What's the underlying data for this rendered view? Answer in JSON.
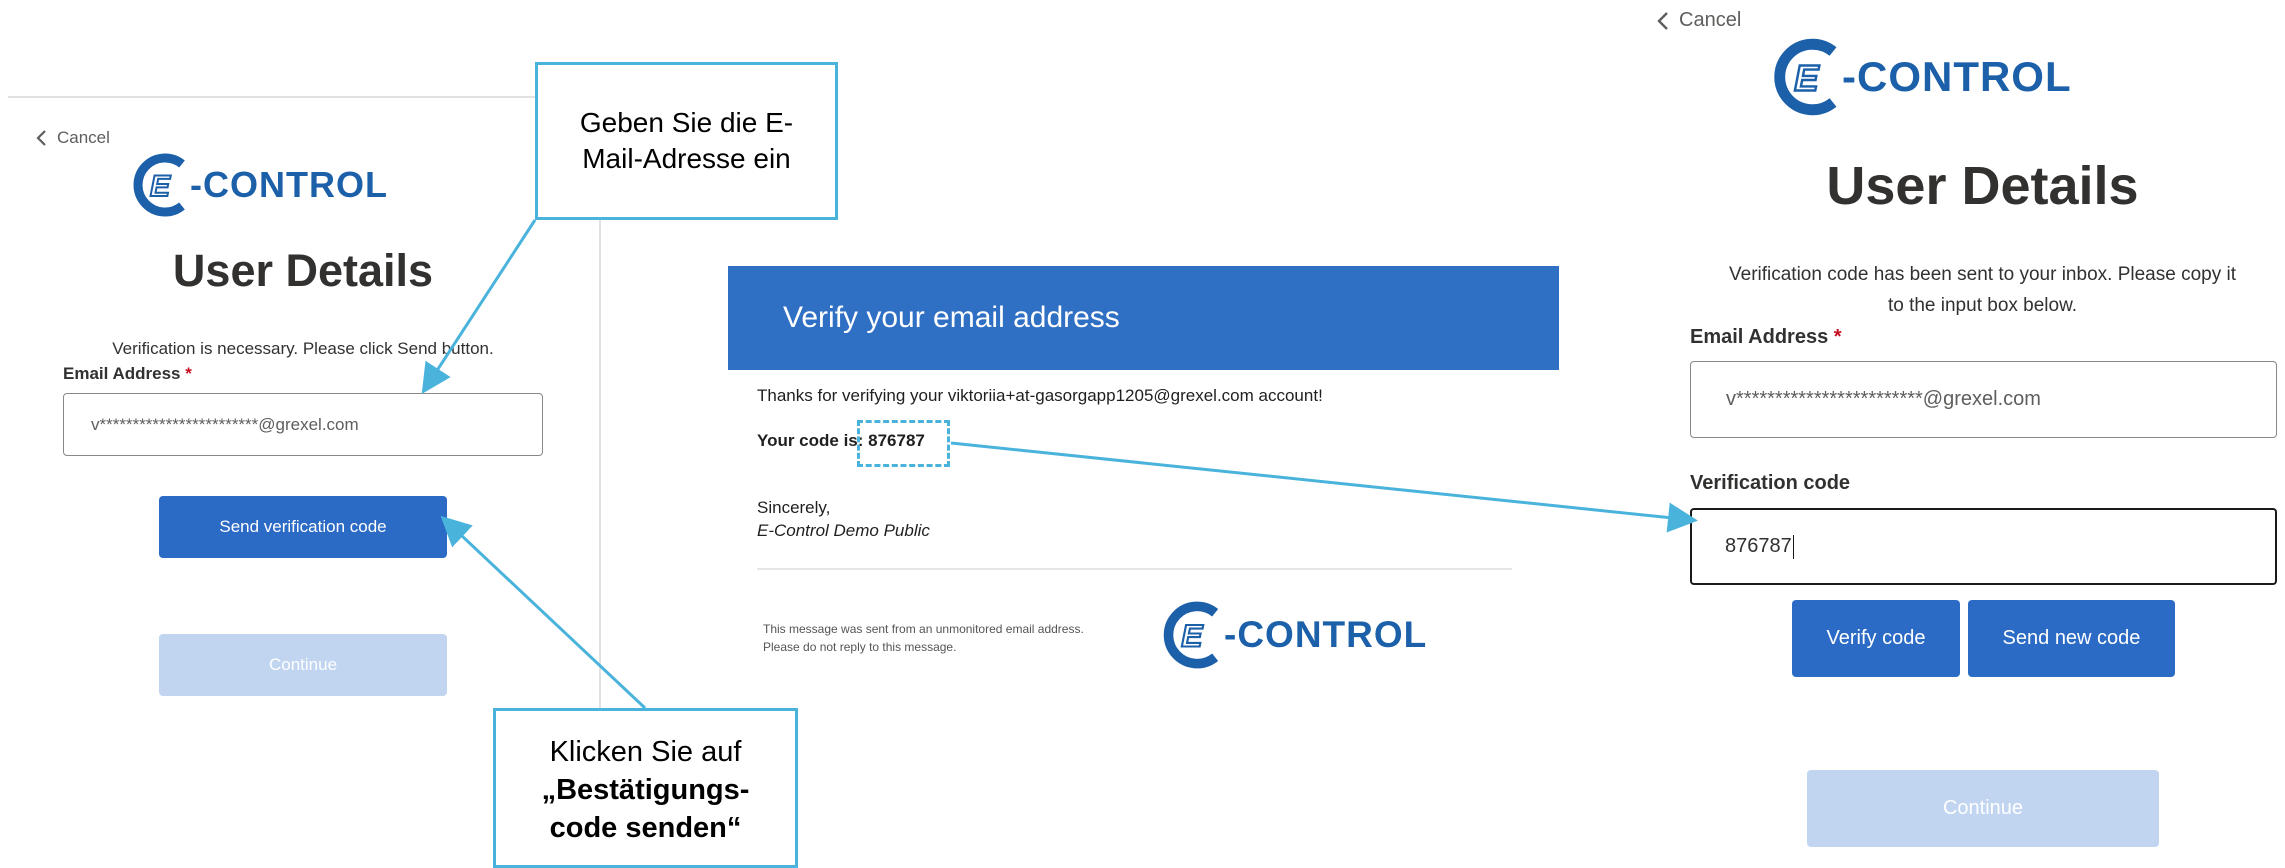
{
  "left_panel": {
    "cancel_label": "Cancel",
    "logo_text": "-CONTROL",
    "logo_letter": "E",
    "title": "User Details",
    "info_text": "Verification is necessary. Please click Send button.",
    "email_label": "Email Address",
    "required_mark": "*",
    "email_value": "v************************@grexel.com",
    "send_button": "Send verification code",
    "continue_button": "Continue"
  },
  "email_message": {
    "header": "Verify your email address",
    "thanks_line": "Thanks for verifying your viktoriia+at-gasorgapp1205@grexel.com account!",
    "code_line": "Your code is: 876787",
    "sign_off": "Sincerely,",
    "sender": "E-Control Demo Public",
    "footer_line1": "This message was sent from an unmonitored email address.",
    "footer_line2": "Please do not reply to this message.",
    "logo_text": "-CONTROL",
    "logo_letter": "E"
  },
  "right_panel": {
    "cancel_label": "Cancel",
    "logo_text": "-CONTROL",
    "logo_letter": "E",
    "title": "User Details",
    "info_line1": "Verification code has been sent to your inbox. Please copy it",
    "info_line2": "to the input box below.",
    "email_label": "Email Address",
    "required_mark": "*",
    "email_value": "v************************@grexel.com",
    "code_label": "Verification code",
    "code_value": "876787",
    "verify_button": "Verify code",
    "send_new_button": "Send new code",
    "continue_button": "Continue"
  },
  "callouts": {
    "enter_email_line1": "Geben Sie die E-",
    "enter_email_line2": "Mail-Adresse ein",
    "click_line1": "Klicken Sie auf",
    "click_line2": "„Bestätigungs-",
    "click_line3": "code senden“"
  },
  "colors": {
    "brand_blue": "#1b60a9",
    "button_blue": "#2b6bc5",
    "email_header_blue": "#3070c4",
    "callout_blue": "#4ab3dc",
    "disabled_button": "#c1d5f0"
  }
}
